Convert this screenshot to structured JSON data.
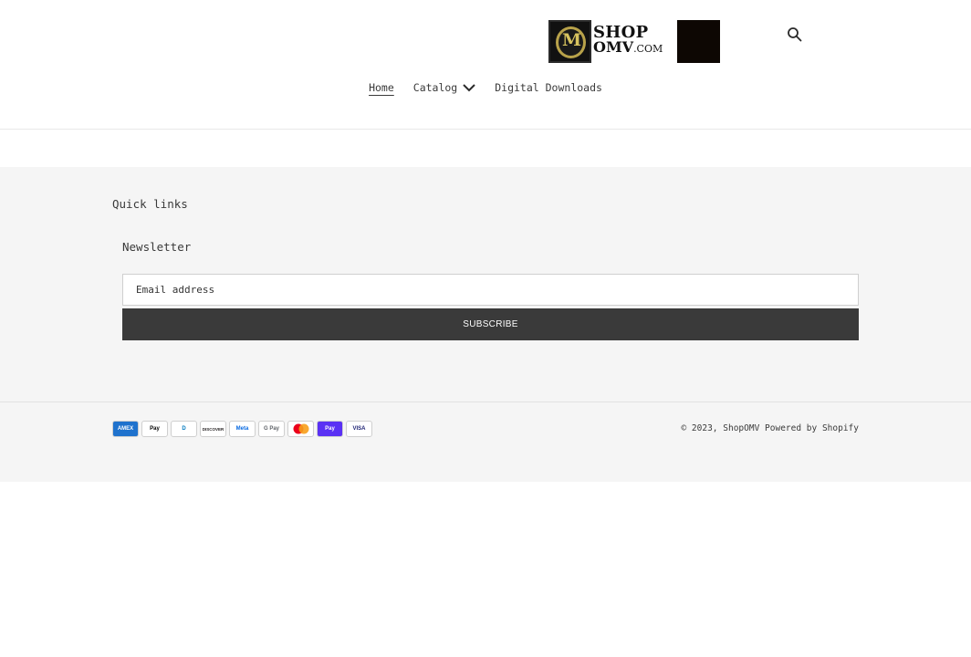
{
  "header": {
    "logo": {
      "emblem_letter": "M",
      "line1": "SHOP",
      "line2": "OMV",
      "line2_suffix": ".COM",
      "alt": "ShopOMV"
    },
    "search_icon": "search-icon",
    "nav": [
      {
        "label": "Home",
        "active": true
      },
      {
        "label": "Catalog",
        "has_dropdown": true
      },
      {
        "label": "Digital Downloads"
      }
    ]
  },
  "footer": {
    "quick_links_heading": "Quick links",
    "newsletter_heading": "Newsletter",
    "email_placeholder": "Email address",
    "subscribe_label": "SUBSCRIBE",
    "payments": [
      {
        "name": "American Express",
        "text": "AMEX",
        "bg": "#1f72cd",
        "fg": "#ffffff"
      },
      {
        "name": "Apple Pay",
        "text": "Pay",
        "bg": "#ffffff",
        "fg": "#000000"
      },
      {
        "name": "Diners Club",
        "text": "D",
        "bg": "#ffffff",
        "fg": "#0079be"
      },
      {
        "name": "Discover",
        "text": "DISCOVER",
        "bg": "#ffffff",
        "fg": "#231f20"
      },
      {
        "name": "Meta Pay",
        "text": "Meta",
        "bg": "#ffffff",
        "fg": "#0668e1"
      },
      {
        "name": "Google Pay",
        "text": "G Pay",
        "bg": "#ffffff",
        "fg": "#5f6368"
      },
      {
        "name": "Mastercard",
        "text": "",
        "bg": "#ffffff",
        "fg": "#000000"
      },
      {
        "name": "Shop Pay",
        "text": "Pay",
        "bg": "#5a31f4",
        "fg": "#ffffff"
      },
      {
        "name": "Visa",
        "text": "VISA",
        "bg": "#ffffff",
        "fg": "#1a1f71"
      }
    ],
    "copyright_prefix": "© 2023,",
    "store_name": "ShopOMV",
    "powered_by": "Powered by Shopify"
  },
  "colors": {
    "footer_bg": "#f5f5f5",
    "button_bg": "#3a3a3a",
    "text": "#3a3a3a"
  }
}
